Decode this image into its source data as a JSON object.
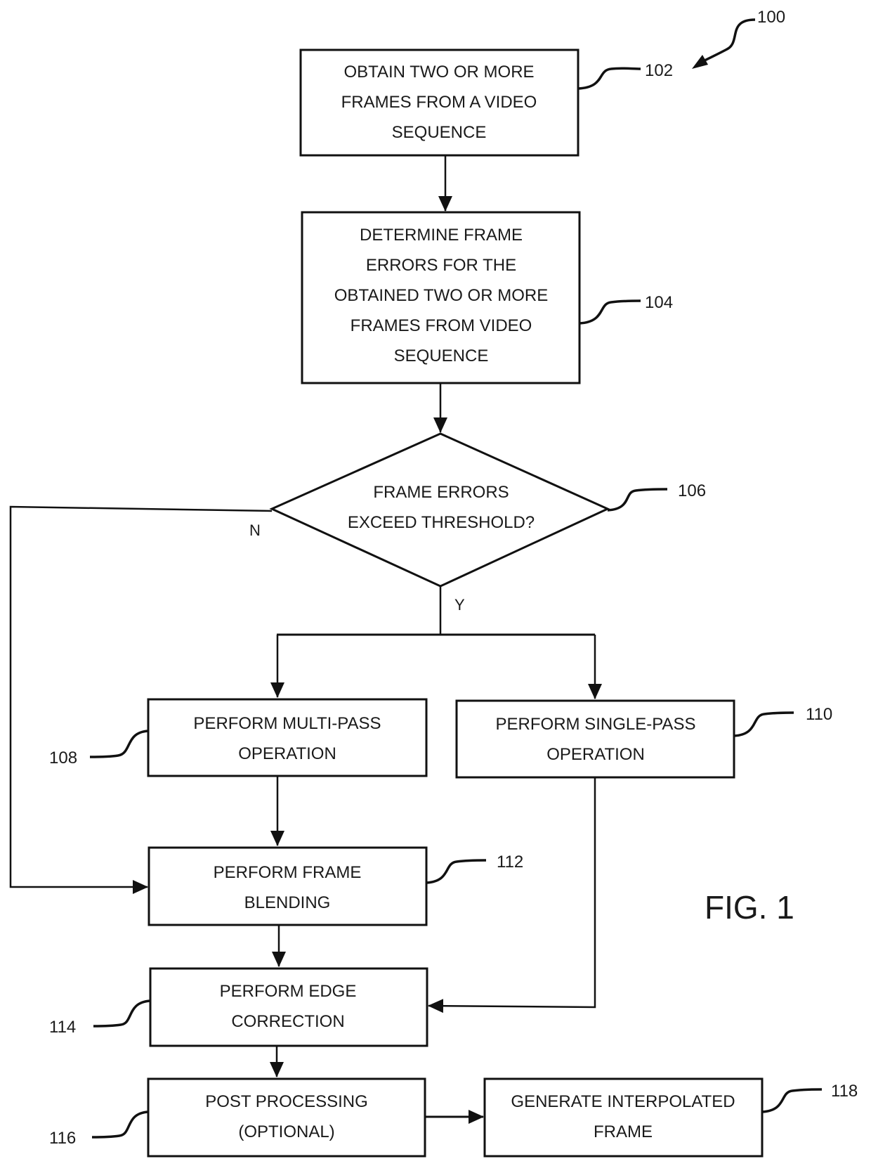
{
  "figure": {
    "label": "FIG. 1",
    "reference": "100"
  },
  "steps": [
    {
      "id": "102",
      "type": "process",
      "lines": [
        "OBTAIN TWO OR MORE",
        "FRAMES FROM A VIDEO",
        "SEQUENCE"
      ]
    },
    {
      "id": "104",
      "type": "process",
      "lines": [
        "DETERMINE FRAME",
        "ERRORS FOR THE",
        "OBTAINED TWO OR MORE",
        "FRAMES FROM VIDEO",
        "SEQUENCE"
      ]
    },
    {
      "id": "106",
      "type": "decision",
      "lines": [
        "FRAME ERRORS",
        "EXCEED THRESHOLD?"
      ]
    },
    {
      "id": "108",
      "type": "process",
      "lines": [
        "PERFORM MULTI-PASS",
        "OPERATION"
      ]
    },
    {
      "id": "110",
      "type": "process",
      "lines": [
        "PERFORM SINGLE-PASS",
        "OPERATION"
      ]
    },
    {
      "id": "112",
      "type": "process",
      "lines": [
        "PERFORM FRAME",
        "BLENDING"
      ]
    },
    {
      "id": "114",
      "type": "process",
      "lines": [
        "PERFORM EDGE",
        "CORRECTION"
      ]
    },
    {
      "id": "116",
      "type": "process",
      "lines": [
        "POST PROCESSING",
        "(OPTIONAL)"
      ]
    },
    {
      "id": "118",
      "type": "process",
      "lines": [
        "GENERATE INTERPOLATED",
        "FRAME"
      ]
    }
  ],
  "branches": {
    "no_label": "N",
    "yes_label": "Y"
  },
  "connections": [
    {
      "from": "102",
      "to": "104"
    },
    {
      "from": "104",
      "to": "106"
    },
    {
      "from": "106",
      "to": "108",
      "branch": "Y"
    },
    {
      "from": "106",
      "to": "110",
      "branch": "Y"
    },
    {
      "from": "106",
      "to": "112",
      "branch": "N"
    },
    {
      "from": "108",
      "to": "112"
    },
    {
      "from": "110",
      "to": "114"
    },
    {
      "from": "112",
      "to": "114"
    },
    {
      "from": "114",
      "to": "116"
    },
    {
      "from": "116",
      "to": "118"
    }
  ]
}
